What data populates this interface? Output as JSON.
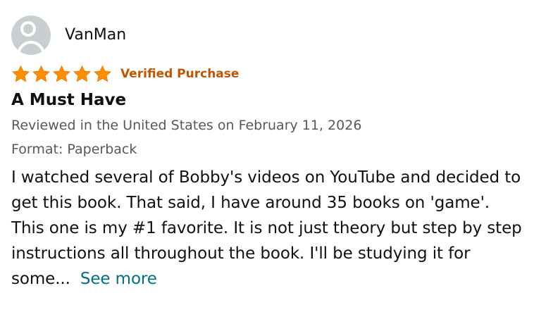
{
  "reviewer": {
    "name": "VanMan",
    "avatar_icon": "default-profile-avatar-icon"
  },
  "rating": {
    "stars": 5,
    "max_stars": 5,
    "star_color": "#ff8f00",
    "star_icon": "star-icon"
  },
  "badge": {
    "label": "Verified Purchase",
    "color": "#c45500"
  },
  "review": {
    "title": "A Must Have",
    "date_line": "Reviewed in the United States on February 11, 2026",
    "format_line": "Format: Paperback",
    "body": "I watched several of Bobby's videos on YouTube and decided to get this book. That said, I have around 35 books on 'game'. This one is my #1 favorite. It is not just theory but step by step instructions all throughout the book. I'll be studying it for some...",
    "see_more_label": "See more",
    "link_color": "#007185"
  }
}
